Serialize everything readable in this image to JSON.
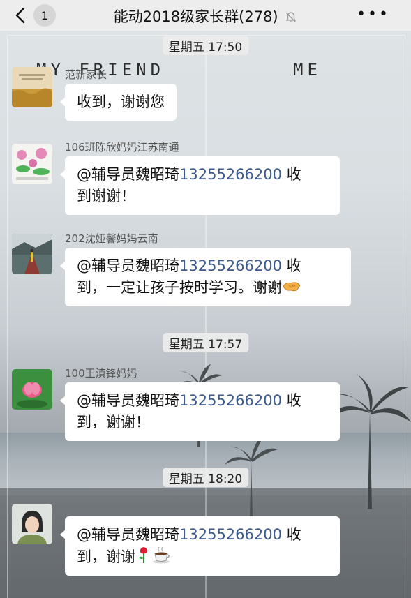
{
  "header": {
    "back_badge": "1",
    "title": "能动2018级家长群(278)"
  },
  "background_text": {
    "left": "MY FRIEND",
    "right": "ME"
  },
  "timestamps": [
    "星期五 17:50",
    "星期五 17:57",
    "星期五 18:20"
  ],
  "messages": [
    {
      "sender": "范新家长",
      "line1": "收到，谢谢您"
    },
    {
      "sender": "106班陈欣妈妈江苏南通",
      "prefix": "@辅导员魏昭琦",
      "phone": "13255266200",
      "suffix1": " 收",
      "line2": "到谢谢！"
    },
    {
      "sender": "202沈娅馨妈妈云南",
      "prefix": "@辅导员魏昭琦",
      "phone": "13255266200",
      "suffix1": " 收",
      "line2": "到，一定让孩子按时学习。谢谢"
    },
    {
      "sender": "100王滇锋妈妈",
      "prefix": "@辅导员魏昭琦",
      "phone": "13255266200",
      "suffix1": " 收",
      "line2": "到，谢谢！"
    },
    {
      "sender": "",
      "prefix": "@辅导员魏昭琦",
      "phone": "13255266200",
      "suffix1": " 收",
      "line2": "到，谢谢"
    }
  ],
  "colors": {
    "header_bg": "#ededed",
    "bubble_bg": "#ffffff",
    "phone_link": "#3b5a8e"
  },
  "icons": [
    "back-chevron-icon",
    "mute-bell-icon",
    "more-icon",
    "handshake-emoji-icon",
    "rose-emoji-icon",
    "coffee-emoji-icon"
  ]
}
